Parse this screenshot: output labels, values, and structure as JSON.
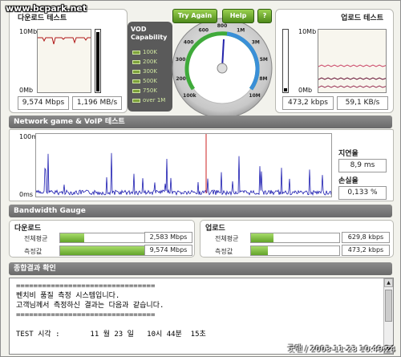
{
  "watermark": "www.bcpark.net",
  "signature": "굿맨 / 2003-11-23 10:49:24",
  "download": {
    "title": "다운로드 테스트",
    "axis_top": "10Mb",
    "axis_bottom": "0Mb",
    "speed": "9,574 Mbps",
    "bytes": "1,196 MB/s",
    "level": 0.95
  },
  "upload": {
    "title": "업로드 테스트",
    "axis_top": "10Mb",
    "axis_bottom": "0Mb",
    "speed": "473,2 kbps",
    "bytes": "59,1 KB/s",
    "level": 0.05
  },
  "buttons": {
    "try_again": "Try Again",
    "help": "Help",
    "help_icon": "?"
  },
  "vod": {
    "title_line1": "VOD",
    "title_line2": "Capability",
    "levels": [
      "100K",
      "200K",
      "300K",
      "500K",
      "750K",
      "over 1M"
    ]
  },
  "gauge": {
    "ticks": [
      "100k",
      "200",
      "300",
      "400",
      "600",
      "800",
      "1M",
      "3M",
      "5M",
      "8M",
      "10M"
    ]
  },
  "network": {
    "section": "Network game & VoIP 테스트",
    "axis_top": "100m",
    "axis_bottom": "0ms",
    "latency_label": "지연율",
    "latency_value": "8,9 ms",
    "loss_label": "손실율",
    "loss_value": "0,133 %"
  },
  "bandwidth": {
    "section": "Bandwidth Gauge",
    "download_title": "다운로드",
    "upload_title": "업로드",
    "avg_label": "전체평균",
    "measured_label": "측정값",
    "download_avg": "2,583 Mbps",
    "download_measured": "9,574 Mbps",
    "upload_avg": "629,8 kbps",
    "upload_measured": "473,2 kbps",
    "download_avg_fill": 0.27,
    "download_measured_fill": 1.0,
    "upload_avg_fill": 0.25,
    "upload_measured_fill": 0.19
  },
  "result": {
    "section": "종합결과 확인",
    "lines": [
      "================================",
      "벤치비 품질 측정 시스템입니다.",
      "고객님께서 측정하신 결과는 다음과 같습니다.",
      "================================",
      "",
      "TEST 시각 :       11 월 23 일   10시 44분  15초"
    ]
  },
  "colors": {
    "accent_green": "#6aaa2a",
    "section_bar": "#7a7a7a",
    "spike": "#cc2222",
    "network_line": "#1b1bb0"
  }
}
